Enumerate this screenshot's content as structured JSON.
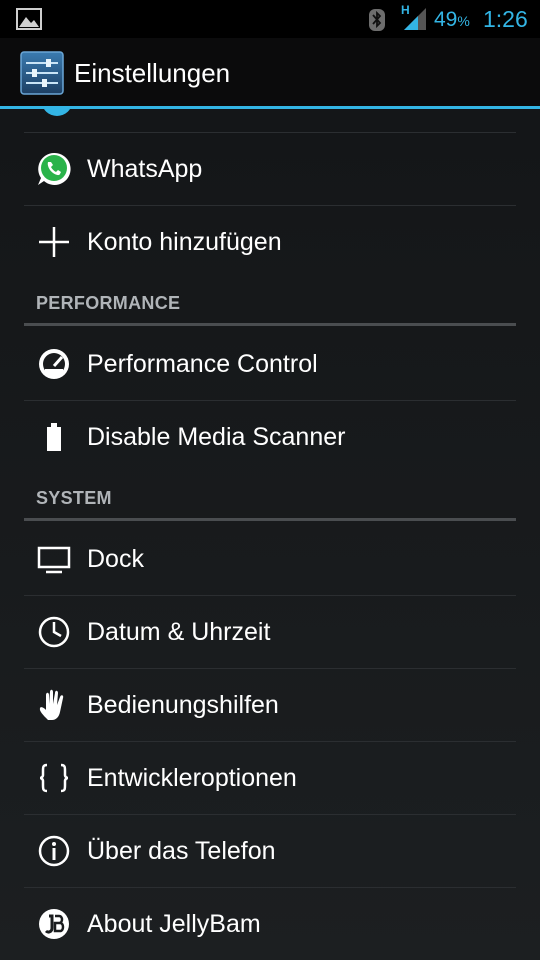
{
  "status_bar": {
    "network_type": "H",
    "battery_percent": "49",
    "battery_unit": "%",
    "time": "1:26"
  },
  "action_bar": {
    "title": "Einstellungen"
  },
  "accounts": {
    "items": [
      {
        "label": "WhatsApp",
        "icon": "whatsapp-icon"
      },
      {
        "label": "Konto hinzufügen",
        "icon": "plus-icon"
      }
    ]
  },
  "performance": {
    "header": "PERFORMANCE",
    "items": [
      {
        "label": "Performance Control",
        "icon": "performance-gauge-icon"
      },
      {
        "label": "Disable Media Scanner",
        "icon": "battery-icon"
      }
    ]
  },
  "system": {
    "header": "SYSTEM",
    "items": [
      {
        "label": "Dock",
        "icon": "monitor-icon"
      },
      {
        "label": "Datum & Uhrzeit",
        "icon": "clock-icon"
      },
      {
        "label": "Bedienungshilfen",
        "icon": "hand-icon"
      },
      {
        "label": "Entwickleroptionen",
        "icon": "braces-icon"
      },
      {
        "label": "Über das Telefon",
        "icon": "info-icon"
      },
      {
        "label": "About JellyBam",
        "icon": "jellybam-icon"
      }
    ]
  },
  "colors": {
    "accent": "#33b5e5",
    "background": "#101214",
    "divider": "#2b2e31",
    "whatsapp_green": "#2ab34a"
  }
}
